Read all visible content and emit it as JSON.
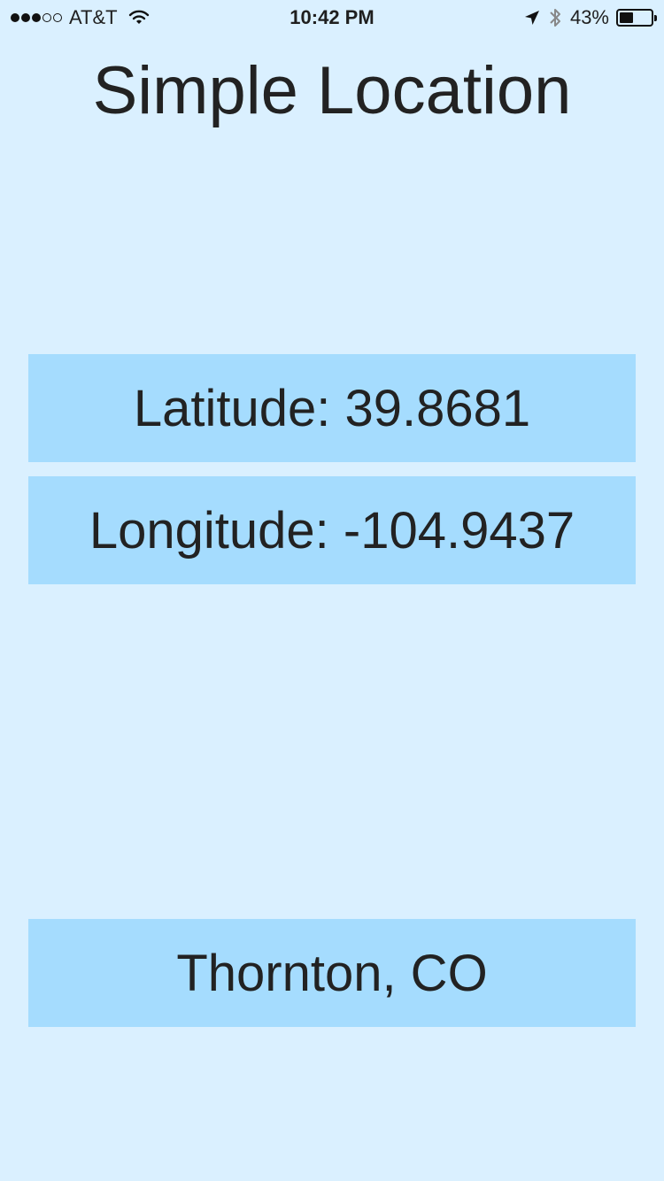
{
  "status_bar": {
    "signal_strength_filled": 3,
    "signal_strength_total": 5,
    "carrier": "AT&T",
    "time": "10:42 PM",
    "battery_percent": "43%",
    "battery_level": 0.43,
    "icons": [
      "wifi-icon",
      "location-arrow-icon",
      "bluetooth-icon",
      "battery-icon"
    ]
  },
  "app": {
    "title": "Simple Location"
  },
  "location": {
    "latitude_text": "Latitude: 39.8681",
    "longitude_text": "Longitude: -104.9437",
    "place_text": "Thornton, CO"
  },
  "colors": {
    "background": "#daf0ff",
    "box": "#a5dcfe",
    "text": "#222222"
  }
}
